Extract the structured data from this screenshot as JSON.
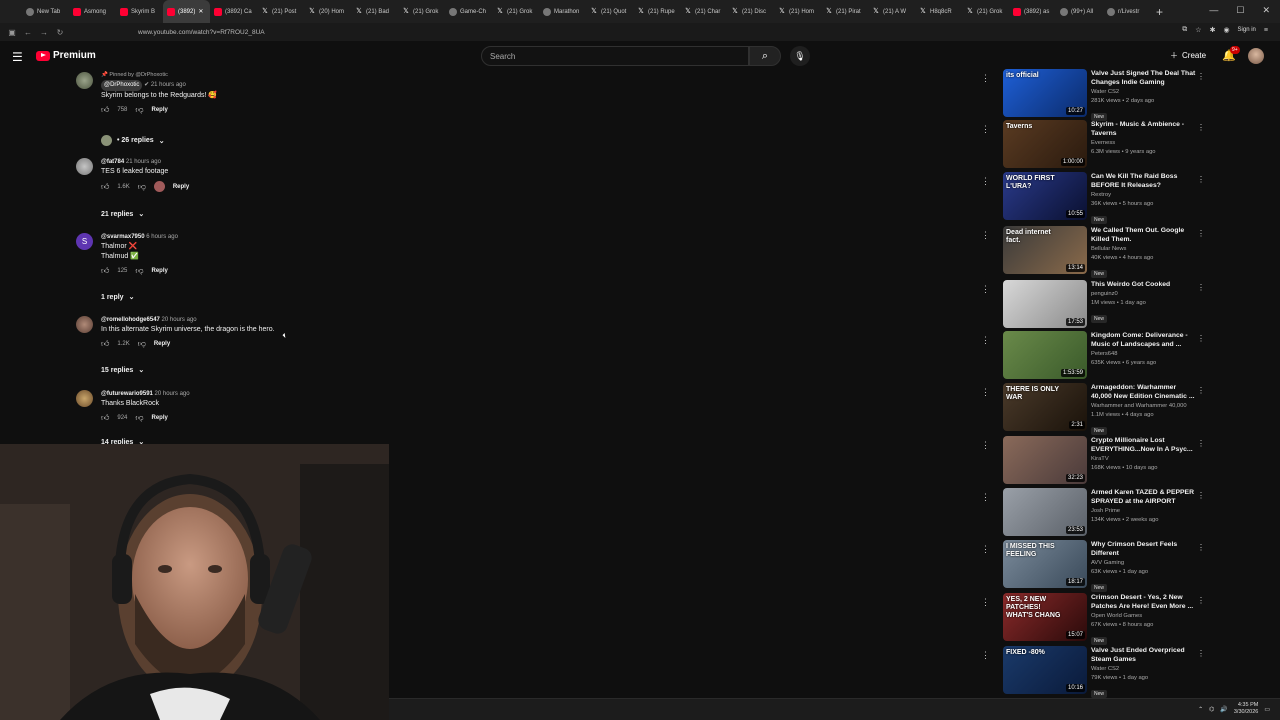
{
  "browser": {
    "tabs": [
      {
        "label": "New Tab",
        "icon": "globe-icon"
      },
      {
        "label": "Asmong",
        "icon": "youtube-icon"
      },
      {
        "label": "Skyrim B",
        "icon": "youtube-icon"
      },
      {
        "label": "(3892)",
        "icon": "youtube-icon",
        "active": true
      },
      {
        "label": "(3892) Ca",
        "icon": "youtube-icon"
      },
      {
        "label": "(21) Post",
        "icon": "x-icon"
      },
      {
        "label": "(20) Hom",
        "icon": "x-icon"
      },
      {
        "label": "(21) Bad",
        "icon": "x-icon"
      },
      {
        "label": "(21) Grok",
        "icon": "x-icon"
      },
      {
        "label": "Game-Ch",
        "icon": "globe-icon"
      },
      {
        "label": "(21) Grok",
        "icon": "x-icon"
      },
      {
        "label": "Marathon",
        "icon": "globe-icon"
      },
      {
        "label": "(21) Quot",
        "icon": "x-icon"
      },
      {
        "label": "(21) Rupe",
        "icon": "x-icon"
      },
      {
        "label": "(21) Char",
        "icon": "x-icon"
      },
      {
        "label": "(21) Disc",
        "icon": "x-icon"
      },
      {
        "label": "(21) Hom",
        "icon": "x-icon"
      },
      {
        "label": "(21) Pirat",
        "icon": "x-icon"
      },
      {
        "label": "(21) A W",
        "icon": "x-icon"
      },
      {
        "label": "H8q8cR",
        "icon": "x-icon"
      },
      {
        "label": "(21) Grok",
        "icon": "x-icon"
      },
      {
        "label": "(3892) as",
        "icon": "youtube-icon"
      },
      {
        "label": "(99+) All",
        "icon": "globe-icon"
      },
      {
        "label": "r/Livestr",
        "icon": "globe-icon"
      }
    ],
    "url": "www.youtube.com/watch?v=Rf7ROU2_8UA",
    "sign_in": "Sign in"
  },
  "header": {
    "logo_text": "Premium",
    "search_placeholder": "Search",
    "create_label": "Create",
    "notification_badge": "9+"
  },
  "comments": [
    {
      "pinned": "Pinned by @DrPhoxotic",
      "author": "@DrPhoxotic",
      "time": "21 hours ago",
      "text": "Skyrim belongs to the Redguards! 🥰",
      "likes": "758",
      "reply": "Reply",
      "replies": "• 26 replies"
    },
    {
      "author": "@fat784",
      "time": "21 hours ago",
      "text": "TES 6 leaked footage",
      "likes": "1.6K",
      "reply": "Reply",
      "replies": "21 replies"
    },
    {
      "author": "@svarmax7950",
      "time": "6 hours ago",
      "text": "Thalmor ❌",
      "text2": "Thalmud ✅",
      "likes": "125",
      "reply": "Reply",
      "replies": "1 reply",
      "avatar_letter": "S"
    },
    {
      "author": "@romellohodge6547",
      "time": "20 hours ago",
      "text": "In this alternate Skyrim universe, the dragon is the hero.",
      "likes": "1.2K",
      "reply": "Reply",
      "replies": "15 replies"
    },
    {
      "author": "@futurewario9591",
      "time": "20 hours ago",
      "text": "Thanks BlackRock",
      "likes": "924",
      "reply": "Reply",
      "replies": "14 replies"
    }
  ],
  "recommendations": [
    {
      "title": "Valve Just Signed The Deal That Changes Indie Gaming",
      "channel": "Water CS2",
      "stats": "281K views • 2 days ago",
      "duration": "10:27",
      "new": "New",
      "thumb_text": "its official"
    },
    {
      "title": "Skyrim - Music & Ambience - Taverns",
      "channel": "Everness",
      "stats": "6.3M views • 9 years ago",
      "duration": "1:00:00",
      "thumb_text": "Taverns"
    },
    {
      "title": "Can We Kill The Raid Boss BEFORE It Releases?",
      "channel": "Rextroy",
      "stats": "36K views • 5 hours ago",
      "duration": "10:55",
      "new": "New",
      "thumb_text": "WORLD FIRST L'URA?"
    },
    {
      "title": "We Called Them Out. Google Killed Them.",
      "channel": "Bellular News",
      "stats": "40K views • 4 hours ago",
      "duration": "13:14",
      "new": "New",
      "thumb_text": "Dead internet fact."
    },
    {
      "title": "This Weirdo Got Cooked",
      "channel": "penguinz0",
      "stats": "1M views • 1 day ago",
      "duration": "17:53",
      "new": "New"
    },
    {
      "title": "Kingdom Come: Deliverance - Music of Landscapes and ...",
      "channel": "Peters648",
      "stats": "635K views • 6 years ago",
      "duration": "1:53:59"
    },
    {
      "title": "Armageddon: Warhammer 40,000 New Edition Cinematic ...",
      "channel": "Warhammer and Warhammer 40,000",
      "stats": "1.1M views • 4 days ago",
      "duration": "2:31",
      "new": "New",
      "thumb_text": "THERE IS ONLY WAR"
    },
    {
      "title": "Crypto Millionaire Lost EVERYTHING...Now In A Psyc...",
      "channel": "KiraTV",
      "stats": "168K views • 10 days ago",
      "duration": "32:23"
    },
    {
      "title": "Armed Karen TAZED & PEPPER SPRAYED at the AIRPORT",
      "channel": "Josh Prime",
      "stats": "134K views • 2 weeks ago",
      "duration": "23:53"
    },
    {
      "title": "Why Crimson Desert Feels Different",
      "channel": "AVV Gaming",
      "stats": "63K views • 1 day ago",
      "duration": "18:17",
      "new": "New",
      "thumb_text": "I MISSED THIS FEELING"
    },
    {
      "title": "Crimson Desert - Yes, 2 New Patches Are Here! Even More ...",
      "channel": "Open World Games",
      "stats": "67K views • 8 hours ago",
      "duration": "15:07",
      "new": "New",
      "thumb_text": "YES, 2 NEW PATCHES! WHAT'S CHANG"
    },
    {
      "title": "Valve Just Ended Overpriced Steam Games",
      "channel": "Water CS2",
      "stats": "79K views • 1 day ago",
      "duration": "10:16",
      "new": "New",
      "thumb_text": "FIXED -80%"
    }
  ],
  "taskbar": {
    "time": "4:35 PM",
    "date": "3/30/2026"
  }
}
